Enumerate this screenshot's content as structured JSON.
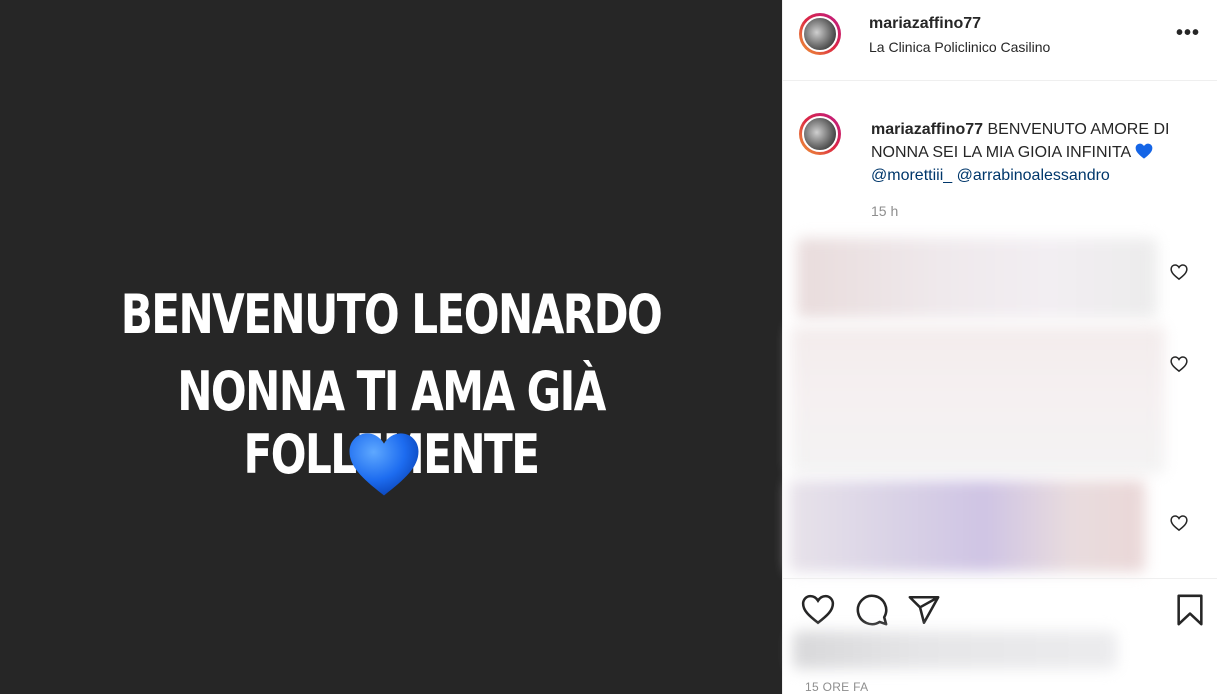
{
  "post": {
    "story_line1": "BENVENUTO LEONARDO",
    "story_line2": "NONNA TI AMA GIÀ FOLLEMENTE"
  },
  "header": {
    "username": "mariazaffino77",
    "location": "La Clinica Policlinico Casilino",
    "more": "•••"
  },
  "caption": {
    "username": "mariazaffino77",
    "text": " BENVENUTO AMORE DI NONNA SEI LA MIA GIOIA INFINITA ",
    "mention1": "@morettiii_",
    "mention2": "@arrabinoalessandro",
    "time": "15 h"
  },
  "footer": {
    "time_ago": "15 ORE FA"
  },
  "colors": {
    "heart": "#1565e6",
    "mention": "#00376b",
    "media_bg": "#262626"
  }
}
